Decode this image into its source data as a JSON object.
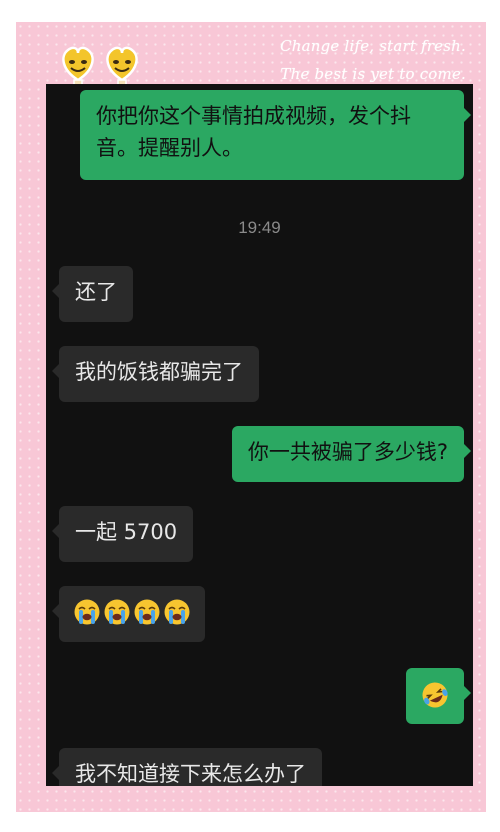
{
  "decor": {
    "caption_line1": "Change life, start fresh.",
    "caption_line2": "The best is yet to come."
  },
  "chat": {
    "messages": [
      {
        "side": "out",
        "text": "你把你这个事情拍成视频，发个抖音。提醒别人。"
      },
      {
        "side": "time",
        "text": "19:49"
      },
      {
        "side": "in",
        "text": "还了"
      },
      {
        "side": "in",
        "text": "我的饭钱都骗完了"
      },
      {
        "side": "out",
        "text": "你一共被骗了多少钱?"
      },
      {
        "side": "in",
        "text": "一起 5700"
      },
      {
        "side": "in",
        "emoji": "crying-face-x4"
      },
      {
        "side": "out",
        "emoji": "rolling-laughing"
      },
      {
        "side": "in",
        "text": "我不知道接下来怎么办了"
      }
    ]
  },
  "colors": {
    "frame_pink": "#f8c7d6",
    "screen_bg": "#111111",
    "outgoing_bubble": "#2ba862",
    "incoming_bubble": "#2a2a2a",
    "timestamp_text": "#8a8a8a"
  }
}
